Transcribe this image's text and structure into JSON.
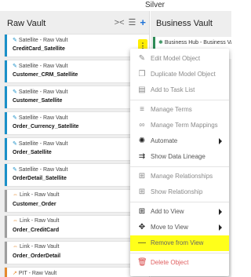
{
  "topbar": {
    "label": "Silver"
  },
  "left_column": {
    "title": "Raw Vault",
    "icons": [
      "collapse-icon",
      "sort-icon",
      "add-icon"
    ],
    "cards": [
      {
        "type": "Satellite - Raw Vault",
        "name": "CreditCard_Satellite",
        "kind": "satellite",
        "selected": true
      },
      {
        "type": "Satellite - Raw Vault",
        "name": "Customer_CRM_Satellite",
        "kind": "satellite"
      },
      {
        "type": "Satellite - Raw Vault",
        "name": "Customer_Satellite",
        "kind": "satellite"
      },
      {
        "type": "Satellite - Raw Vault",
        "name": "Order_Currency_Satellite",
        "kind": "satellite"
      },
      {
        "type": "Satellite - Raw Vault",
        "name": "Order_Satellite",
        "kind": "satellite"
      },
      {
        "type": "Satellite - Raw Vault",
        "name": "OrderDetail_Satellite",
        "kind": "satellite"
      },
      {
        "type": "Link - Raw Vault",
        "name": "Customer_Order",
        "kind": "link"
      },
      {
        "type": "Link - Raw Vault",
        "name": "Order_CreditCard",
        "kind": "link"
      },
      {
        "type": "Link - Raw Vault",
        "name": "Order_OrderDetail",
        "kind": "link"
      },
      {
        "type": "PIT - Raw Vault",
        "name": "",
        "kind": "pit"
      }
    ]
  },
  "right_column": {
    "title": "Business Vault",
    "card": {
      "type": "Business Hub - Business Vault",
      "name": ""
    }
  },
  "context_menu": {
    "items": [
      {
        "label": "Edit Model Object",
        "icon": "edit-icon"
      },
      {
        "label": "Duplicate Model Object",
        "icon": "duplicate-icon"
      },
      {
        "label": "Add to Task List",
        "icon": "task-list-icon"
      },
      {
        "label": "Manage Terms",
        "icon": "terms-icon"
      },
      {
        "label": "Manage Term Mappings",
        "icon": "link-icon"
      },
      {
        "label": "Automate",
        "icon": "automate-icon",
        "submenu": true
      },
      {
        "label": "Show Data Lineage",
        "icon": "lineage-icon"
      },
      {
        "label": "Manage Relationships",
        "icon": "relationships-icon"
      },
      {
        "label": "Show Relationship",
        "icon": "relationship-icon"
      },
      {
        "label": "Add to View",
        "icon": "add-view-icon",
        "submenu": true
      },
      {
        "label": "Move to View",
        "icon": "move-view-icon",
        "submenu": true
      },
      {
        "label": "Remove from View",
        "icon": "remove-icon",
        "highlighted": true
      },
      {
        "label": "Delete Object",
        "icon": "delete-icon",
        "danger": true
      }
    ]
  },
  "colors": {
    "satellite_accent": "#1a90c8",
    "link_accent": "#9e9e9e",
    "business_hub_accent": "#2e8b57",
    "highlight": "#ffff1a",
    "danger": "#e06060"
  }
}
